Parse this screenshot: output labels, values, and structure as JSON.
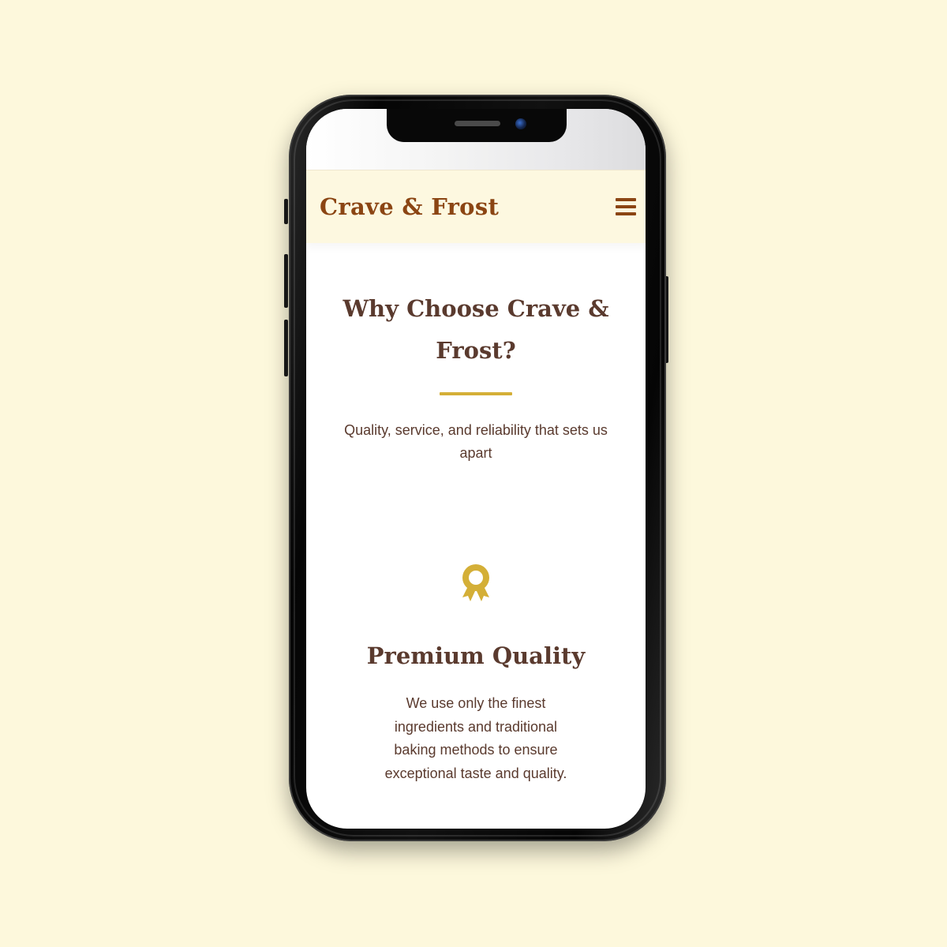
{
  "header": {
    "brand": "Crave & Frost",
    "menu_icon": "hamburger-menu-icon"
  },
  "section": {
    "title": "Why Choose Crave & Frost?",
    "subtitle": "Quality, service, and reliability that sets us apart"
  },
  "feature": {
    "icon": "award-ribbon-icon",
    "title": "Premium Quality",
    "description": "We use only the finest ingredients and traditional baking methods to ensure exceptional taste and quality."
  },
  "colors": {
    "background": "#fdf8dc",
    "brand": "#8b4513",
    "heading": "#5a3a2e",
    "accent": "#d4af37",
    "header_bg": "#fdf8e0"
  }
}
